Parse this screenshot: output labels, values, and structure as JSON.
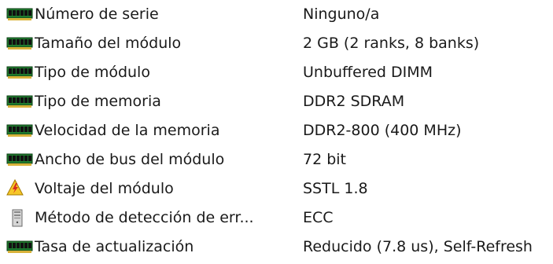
{
  "properties": [
    {
      "icon": "memory-module-icon",
      "label": "Número de serie",
      "value": "Ninguno/a"
    },
    {
      "icon": "memory-module-icon",
      "label": "Tamaño del módulo",
      "value": "2 GB (2 ranks, 8 banks)"
    },
    {
      "icon": "memory-module-icon",
      "label": "Tipo de módulo",
      "value": "Unbuffered DIMM"
    },
    {
      "icon": "memory-module-icon",
      "label": "Tipo de memoria",
      "value": "DDR2 SDRAM"
    },
    {
      "icon": "memory-module-icon",
      "label": "Velocidad de la memoria",
      "value": "DDR2-800 (400 MHz)"
    },
    {
      "icon": "memory-module-icon",
      "label": "Ancho de bus del módulo",
      "value": "72 bit"
    },
    {
      "icon": "voltage-warning-icon",
      "label": "Voltaje del módulo",
      "value": "SSTL 1.8"
    },
    {
      "icon": "computer-tower-icon",
      "label": "Método de detección de err...",
      "value": "ECC"
    },
    {
      "icon": "memory-module-icon",
      "label": "Tasa de actualización",
      "value": "Reducido (7.8 us), Self-Refresh"
    }
  ],
  "colors": {
    "memory_chip_green": "#1f7a2e",
    "memory_chip_black": "#111111",
    "memory_pins_gold": "#d8b23a",
    "warning_yellow": "#f6c628",
    "warning_bolt_red": "#d62d1f"
  }
}
